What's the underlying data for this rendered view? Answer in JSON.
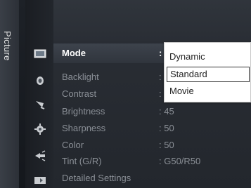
{
  "category": "Picture",
  "icons": [
    "picture-icon",
    "sound-icon",
    "channel-icon",
    "setup-icon",
    "input-icon",
    "application-icon"
  ],
  "menu": {
    "selected": {
      "label": "Mode",
      "value": ":"
    },
    "items": [
      {
        "label": "Backlight",
        "value": ":"
      },
      {
        "label": "Contrast",
        "value": ":"
      },
      {
        "label": "Brightness",
        "value": ": 45"
      },
      {
        "label": "Sharpness",
        "value": ": 50"
      },
      {
        "label": "Color",
        "value": ": 50"
      },
      {
        "label": "Tint (G/R)",
        "value": ": G50/R50"
      },
      {
        "label": "Detailed Settings",
        "value": ""
      }
    ]
  },
  "dropdown": {
    "options": [
      "Dynamic",
      "Standard",
      "Movie"
    ],
    "highlighted": "Standard"
  },
  "colors": {
    "background": "#1d2127",
    "selected_text": "#ffffff",
    "item_text": "#8a8f96",
    "dropdown_bg": "#ffffff"
  }
}
